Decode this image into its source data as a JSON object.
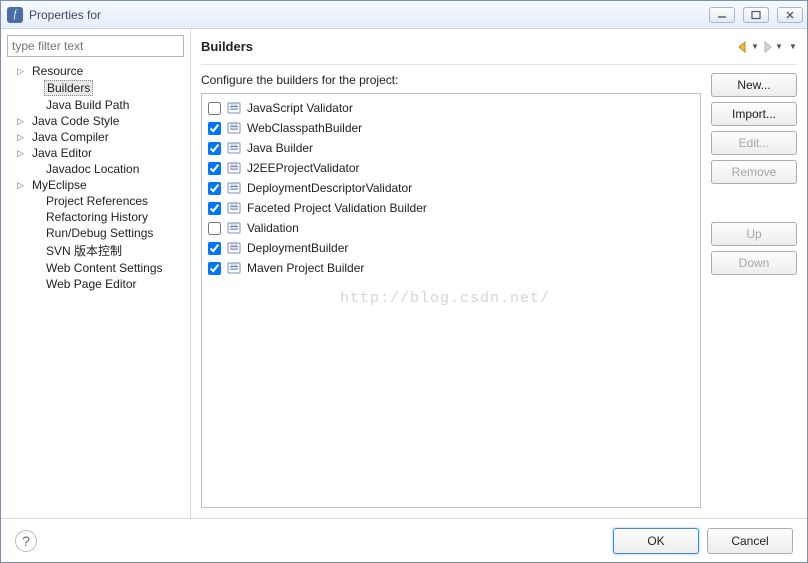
{
  "window": {
    "title": "Properties for"
  },
  "sidebar": {
    "filter_placeholder": "type filter text",
    "items": [
      {
        "label": "Resource",
        "expandable": true,
        "expanded": false,
        "child": false,
        "selected": false
      },
      {
        "label": "Builders",
        "expandable": false,
        "child": true,
        "selected": true
      },
      {
        "label": "Java Build Path",
        "expandable": false,
        "child": true,
        "selected": false
      },
      {
        "label": "Java Code Style",
        "expandable": true,
        "expanded": false,
        "child": false,
        "selected": false
      },
      {
        "label": "Java Compiler",
        "expandable": true,
        "expanded": false,
        "child": false,
        "selected": false
      },
      {
        "label": "Java Editor",
        "expandable": true,
        "expanded": false,
        "child": false,
        "selected": false
      },
      {
        "label": "Javadoc Location",
        "expandable": false,
        "child": true,
        "selected": false
      },
      {
        "label": "MyEclipse",
        "expandable": true,
        "expanded": false,
        "child": false,
        "selected": false
      },
      {
        "label": "Project References",
        "expandable": false,
        "child": true,
        "selected": false
      },
      {
        "label": "Refactoring History",
        "expandable": false,
        "child": true,
        "selected": false
      },
      {
        "label": "Run/Debug Settings",
        "expandable": false,
        "child": true,
        "selected": false
      },
      {
        "label": "SVN 版本控制",
        "expandable": false,
        "child": true,
        "selected": false
      },
      {
        "label": "Web Content Settings",
        "expandable": false,
        "child": true,
        "selected": false
      },
      {
        "label": "Web Page Editor",
        "expandable": false,
        "child": true,
        "selected": false
      }
    ]
  },
  "main": {
    "heading": "Builders",
    "instruction": "Configure the builders for the project:",
    "builders": [
      {
        "checked": false,
        "label": "JavaScript Validator"
      },
      {
        "checked": true,
        "label": "WebClasspathBuilder"
      },
      {
        "checked": true,
        "label": "Java Builder"
      },
      {
        "checked": true,
        "label": "J2EEProjectValidator"
      },
      {
        "checked": true,
        "label": "DeploymentDescriptorValidator"
      },
      {
        "checked": true,
        "label": "Faceted Project Validation Builder"
      },
      {
        "checked": false,
        "label": "Validation"
      },
      {
        "checked": true,
        "label": "DeploymentBuilder"
      },
      {
        "checked": true,
        "label": "Maven Project Builder"
      }
    ],
    "buttons": {
      "new": "New...",
      "import": "Import...",
      "edit": "Edit...",
      "remove": "Remove",
      "up": "Up",
      "down": "Down"
    }
  },
  "footer": {
    "ok": "OK",
    "cancel": "Cancel"
  },
  "watermark": "http://blog.csdn.net/"
}
